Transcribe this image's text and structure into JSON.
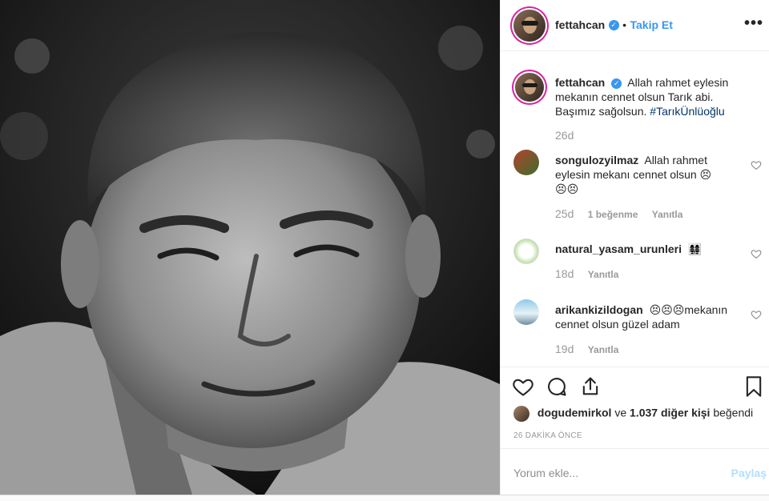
{
  "post": {
    "author": "fettahcan",
    "follow_label": "Takip Et",
    "separator": "•",
    "more_label": "•••",
    "verified_mark": "✓",
    "photo_alt_icon": "portrait-photo"
  },
  "caption": {
    "username": "fettahcan",
    "text": "Allah rahmet eylesin mekanın cennet olsun Tarık abi. Başımız sağolsun.",
    "hashtag": "#TarıkÜnlüoğlu",
    "time": "26d"
  },
  "comments": [
    {
      "username": "songulozyilmaz",
      "text": "Allah rahmet eylesin mekanı cennet olsun 😣😣😣",
      "time": "25d",
      "likes": "1 beğenme",
      "reply": "Yanıtla"
    },
    {
      "username": "natural_yasam_urunleri",
      "text": "👩‍👩‍👧‍👧",
      "time": "18d",
      "likes": "",
      "reply": "Yanıtla"
    },
    {
      "username": "arikankizildogan",
      "text": "😣😣😣mekanın cennet olsun güzel adam",
      "time": "19d",
      "likes": "",
      "reply": "Yanıtla"
    }
  ],
  "likes_line": {
    "liker": "dogudemirkol",
    "connector": "ve",
    "others": "1.037 diğer kişi",
    "suffix": "beğendi"
  },
  "timestamp": "26 DAKİKA ÖNCE",
  "comment_input": {
    "placeholder": "Yorum ekle...",
    "post_label": "Paylaş"
  },
  "icons": {
    "like": "heart-icon",
    "comment": "comment-bubble-icon",
    "share": "share-icon",
    "save": "bookmark-icon",
    "more": "more-options-icon"
  },
  "colors": {
    "accent": "#3897f0",
    "hashtag": "#003569",
    "muted": "#999999",
    "post_disabled": "#b2dffc",
    "story_ring": "#d6249f"
  }
}
